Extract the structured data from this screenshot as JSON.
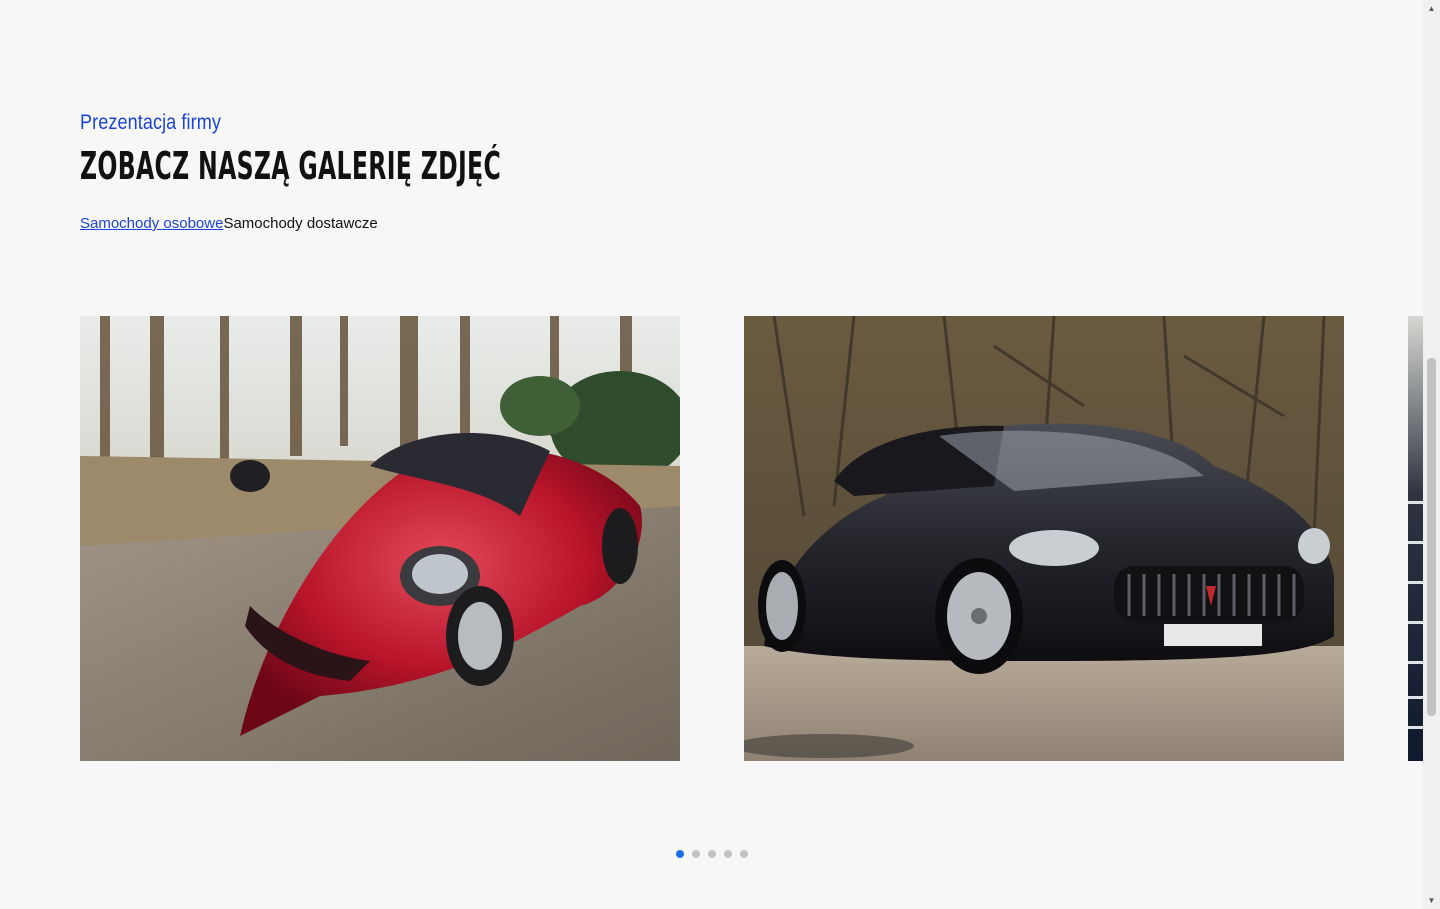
{
  "section": {
    "eyebrow": "Prezentacja firmy",
    "title": "Zobacz naszą galerię zdjęć"
  },
  "tabs": [
    {
      "label": "Samochody osobowe",
      "active": true
    },
    {
      "label": "Samochody dostawcze",
      "active": false
    }
  ],
  "gallery": {
    "slides": [
      {
        "subject": "red sports coupe on forest road"
      },
      {
        "subject": "black convertible grand tourer"
      },
      {
        "subject": "partially visible next slide"
      }
    ],
    "dots_count": 5,
    "active_dot": 1
  },
  "colors": {
    "accent": "#1a44d6",
    "dot_active": "#1a6fe0",
    "dot_inactive": "#c4c4c4",
    "background": "#f7f7f7"
  }
}
